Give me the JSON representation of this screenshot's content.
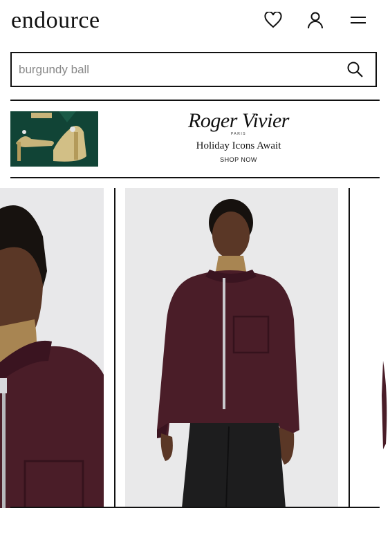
{
  "header": {
    "logo": "endource",
    "icons": [
      "heart-icon",
      "user-icon",
      "menu-icon"
    ]
  },
  "search": {
    "placeholder": "burgundy ball",
    "button_icon": "search-icon"
  },
  "promo": {
    "brand_name": "Roger Vivier",
    "brand_sub": "PARIS",
    "headline": "Holiday Icons Await",
    "cta": "SHOP NOW"
  },
  "carousel": {
    "slides": 3,
    "active_index": 1
  },
  "colors": {
    "text": "#111111",
    "promo_bg": "#114436",
    "jacket": "#4a1d28",
    "turtleneck": "#a88552",
    "photo_bg": "#e9e9ea"
  }
}
